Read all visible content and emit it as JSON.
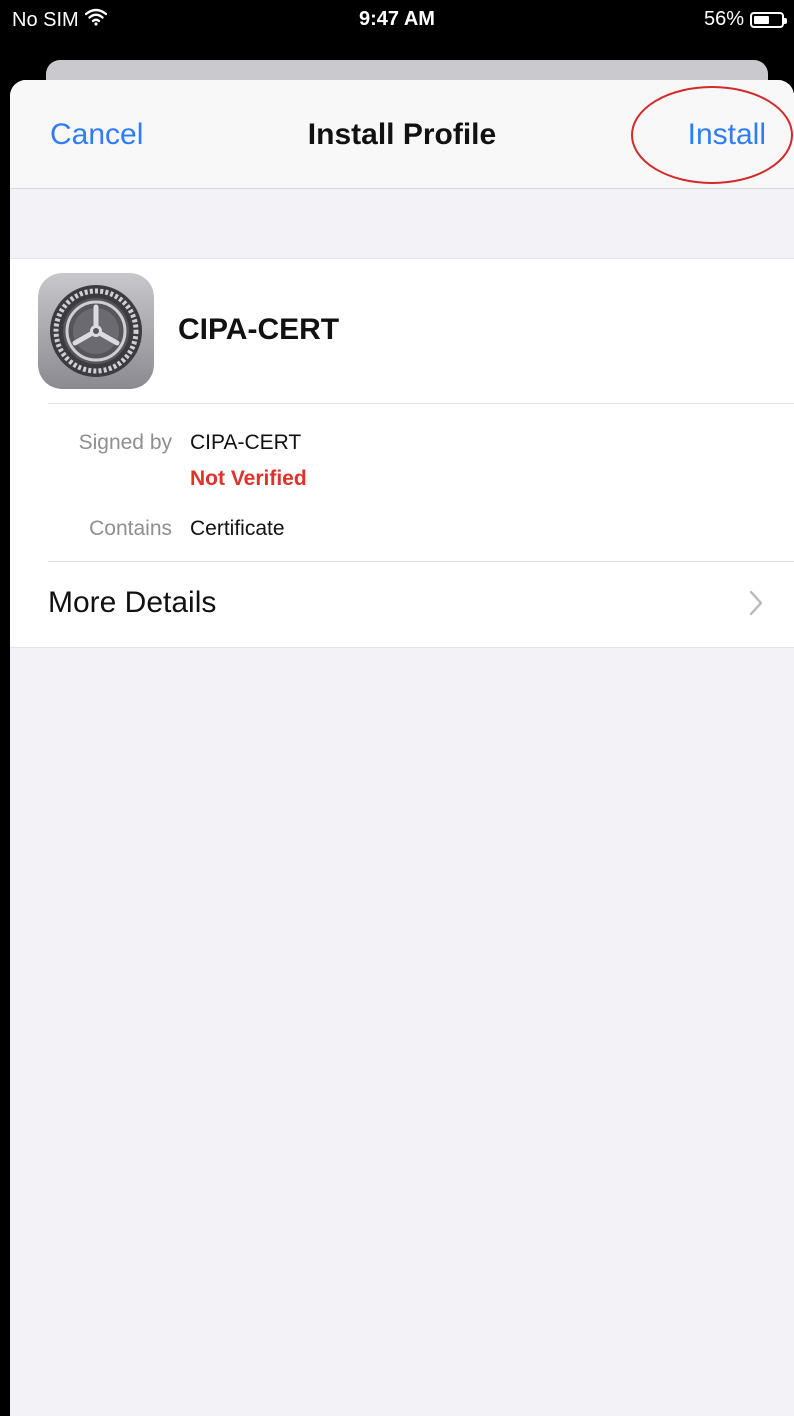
{
  "status_bar": {
    "carrier": "No SIM",
    "wifi_icon": "wifi-icon",
    "time": "9:47 AM",
    "battery_percent_label": "56%",
    "battery_level": 0.56,
    "battery_icon": "battery-icon"
  },
  "nav": {
    "cancel_label": "Cancel",
    "title": "Install Profile",
    "install_label": "Install",
    "link_color": "#2f7cf6",
    "highlight_color": "#d42a2a"
  },
  "profile": {
    "icon": "settings-gear-icon",
    "name": "CIPA-CERT",
    "signed_by_label": "Signed by",
    "signed_by_value": "CIPA-CERT",
    "verification_status": "Not Verified",
    "warning_color": "#e0322b",
    "contains_label": "Contains",
    "contains_value": "Certificate"
  },
  "more_details": {
    "label": "More Details",
    "icon": "chevron-right-icon"
  }
}
